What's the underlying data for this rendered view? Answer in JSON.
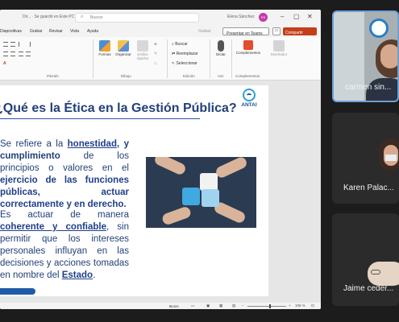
{
  "titlebar": {
    "doc_title": "Dir... ∙ Se guardó en Este PC ∨",
    "search_placeholder": "Buscar",
    "user_name": "Elena Sánchez",
    "avatar_initials": "ES"
  },
  "ribbon_tabs": [
    "Diapositivas",
    "Grabar",
    "Revisar",
    "Vista",
    "Ayuda"
  ],
  "ribbon_right": {
    "grabar": "Grabar",
    "teams": "Presentar en Teams",
    "share": "Compartir"
  },
  "ribbon": {
    "groups": {
      "parrafo": "Párrafo",
      "dibujo": "Dibujo",
      "edicion": "Edición",
      "voz": "Voz",
      "complementos": "Complementos"
    },
    "buttons": {
      "formas": "Formas",
      "organizar": "Organizar",
      "estilos": "Estilos rápidos",
      "dictar": "Dictar",
      "complementos": "Complementos",
      "disenador": "Diseñador"
    },
    "edicion_items": [
      "Buscar",
      "Reemplazar",
      "Seleccionar"
    ]
  },
  "slide": {
    "title": "¿Qué es la Ética en la Gestión Pública?",
    "logo_text": "ANTAI",
    "para1": {
      "t1": "Se refiere a la ",
      "b1": "honestidad",
      "t2": ", y cumplimiento",
      "t3": " de los principios o valores en el ",
      "b2": "ejercicio de las funciones públicas",
      "t4": ", actuar correctamente y en derecho."
    },
    "para2": {
      "t1": "Es actuar de manera ",
      "b1": "coherente y confiable",
      "t2": ", sin permitir que los intereses personales influyan en las decisiones y acciones tomadas en nombre del ",
      "b2": "Estado",
      "t3": "."
    }
  },
  "statusbar": {
    "notes": "Notas",
    "zoom": "108 %"
  },
  "participants": [
    {
      "name": "carmen sin..."
    },
    {
      "name": "Karen Palac..."
    },
    {
      "name": "Jaime ceder..."
    }
  ],
  "colors": {
    "accent": "#c43e1c",
    "slide_text": "#23407a",
    "tile_border": "#6ea0d6"
  }
}
